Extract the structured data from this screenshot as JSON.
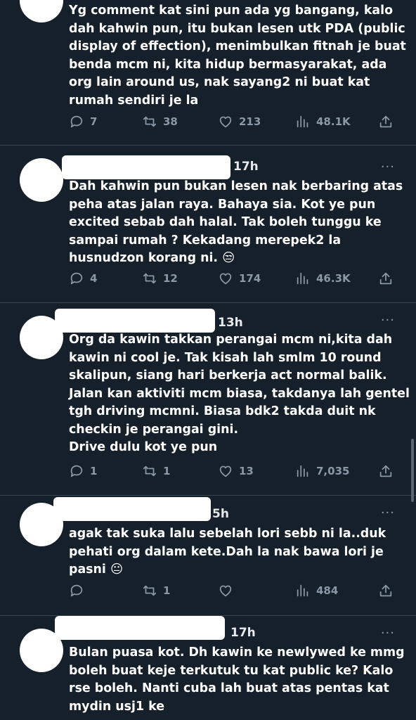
{
  "tweets": [
    {
      "time": "",
      "text": "Yg comment kat sini pun ada yg bangang, kalo dah kahwin pun, itu bukan lesen utk PDA (public display of effection), menimbulkan fitnah je buat benda mcm ni, kita hidup bermasyarakat, ada org lain around us, nak sayang2 ni buat kat rumah sendiri je la",
      "emoji": "",
      "replies": "7",
      "retweets": "38",
      "likes": "213",
      "views": "48.1K"
    },
    {
      "time": "17h",
      "text": "Dah kahwin pun bukan lesen nak berbaring atas peha atas jalan raya. Bahaya sia. Kot ye pun excited sebab dah halal. Tak boleh tunggu ke sampai rumah ? Kekadang merepek2 la husnudzon korang ni.",
      "emoji": "😒",
      "replies": "4",
      "retweets": "12",
      "likes": "174",
      "views": "46.3K"
    },
    {
      "time": "13h",
      "text": "Org da kawin takkan perangai mcm ni,kita dah kawin ni cool je. Tak kisah lah smlm 10 round skalipun, siang hari berkerja act normal balik. Jalan kan aktiviti mcm biasa, takdanya lah gentel tgh driving mcmni. Biasa bdk2 takda duit nk checkin je perangai gini.\nDrive dulu kot ye pun",
      "emoji": "",
      "replies": "1",
      "retweets": "1",
      "likes": "13",
      "views": "7,035"
    },
    {
      "time": "5h",
      "text": "agak tak suka lalu sebelah lori sebb ni la..duk pehati org dalam kete.Dah la nak bawa lori je pasni",
      "emoji": "😐",
      "replies": "",
      "retweets": "1",
      "likes": "",
      "views": "484"
    },
    {
      "time": "17h",
      "text": "Bulan puasa kot. Dh kawin ke newlywed ke mmg boleh buat keje terkutuk tu kat public ke? Kalo rse boleh. Nanti cuba lah buat atas pentas kat mydin usj1 ke",
      "emoji": "",
      "replies": "",
      "retweets": "",
      "likes": "",
      "views": ""
    }
  ],
  "more_label": "···",
  "icons": [
    "reply-icon",
    "retweet-icon",
    "like-icon",
    "views-icon",
    "share-icon"
  ],
  "colors": {
    "background": "#15202b",
    "muted": "#8b98a5",
    "divider": "#38444d"
  }
}
